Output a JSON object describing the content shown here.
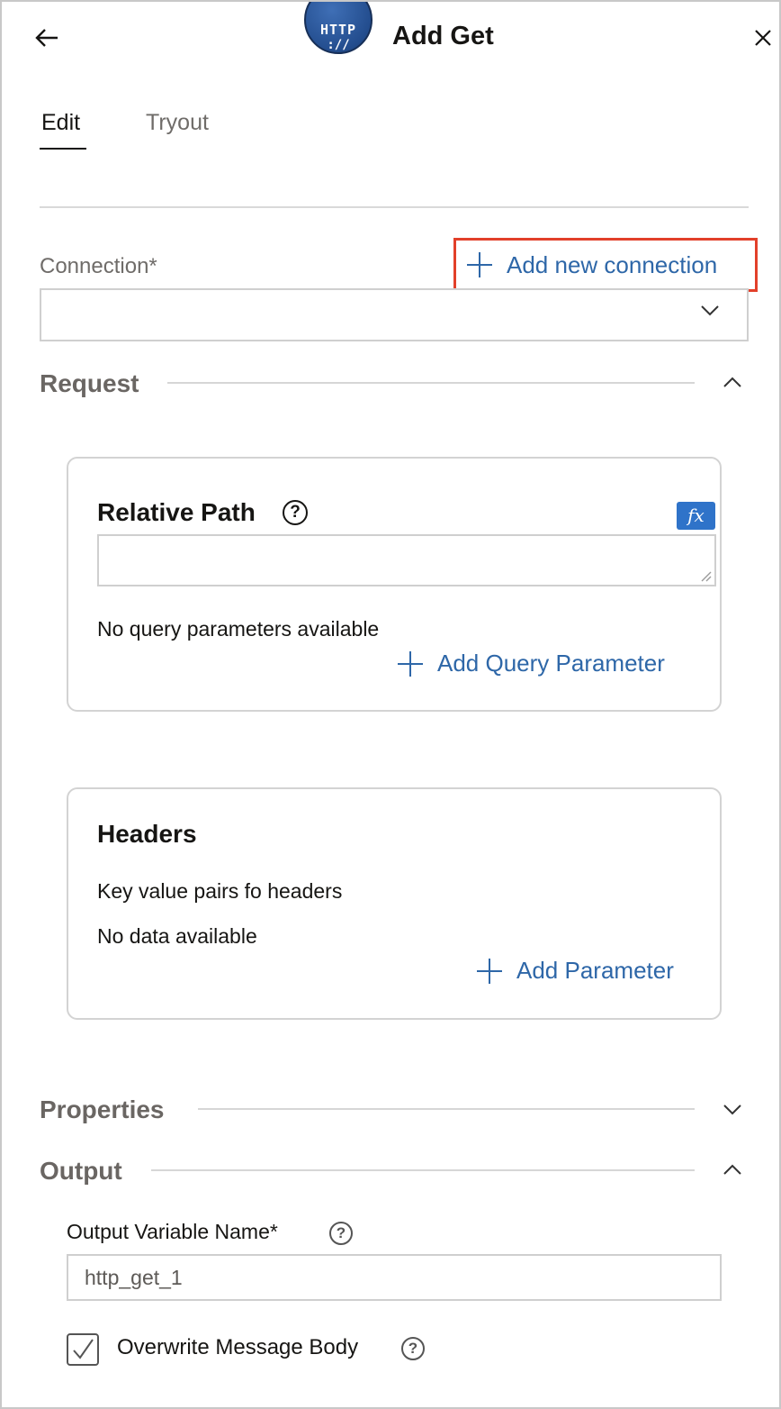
{
  "header": {
    "title": "Add Get",
    "logo_line1": "HTTP",
    "logo_line2": "://",
    "back_icon": "arrow-left-icon",
    "close_icon": "close-icon"
  },
  "tabs": [
    {
      "label": "Edit",
      "active": true
    },
    {
      "label": "Tryout",
      "active": false
    }
  ],
  "connection": {
    "label": "Connection*",
    "add_label": "Add new connection",
    "selected_value": ""
  },
  "request": {
    "title": "Request",
    "expanded": true,
    "relative_path": {
      "title": "Relative Path",
      "fx_label": "fx",
      "value": "",
      "empty_text": "No query parameters available",
      "add_label": "Add Query Parameter"
    },
    "headers": {
      "title": "Headers",
      "description": "Key value pairs fo headers",
      "empty_text": "No data available",
      "add_label": "Add Parameter"
    }
  },
  "properties": {
    "title": "Properties",
    "expanded": false
  },
  "output": {
    "title": "Output",
    "expanded": true,
    "variable_label": "Output Variable Name*",
    "variable_value": "http_get_1",
    "overwrite_label": "Overwrite Message Body",
    "overwrite_checked": true
  },
  "colors": {
    "link": "#2e67a8",
    "highlight": "#e2402a",
    "fx_button": "#2f73c9"
  }
}
